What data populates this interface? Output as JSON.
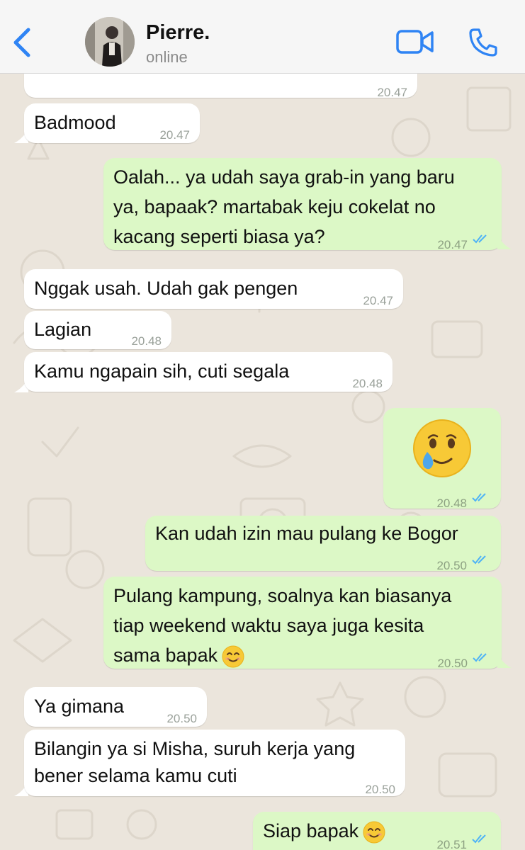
{
  "header": {
    "contact_name": "Pierre.",
    "status": "online"
  },
  "colors": {
    "accent": "#2f84f4",
    "outgoing_bubble": "#dcf8c6",
    "incoming_bubble": "#ffffff",
    "read_ticks": "#4fb3f6",
    "wallpaper": "#ebe5dc"
  },
  "messages": [
    {
      "dir": "in",
      "lines": [
        ""
      ],
      "time": "20.47"
    },
    {
      "dir": "in",
      "lines": [
        "Badmood"
      ],
      "time": "20.47"
    },
    {
      "dir": "out",
      "lines": [
        "Oalah... ya udah saya grab-in yang baru",
        "ya, bapaak? martabak keju cokelat no",
        "kacang seperti biasa ya?"
      ],
      "time": "20.47",
      "read": true
    },
    {
      "dir": "in",
      "lines": [
        "Nggak usah. Udah gak pengen"
      ],
      "time": "20.47"
    },
    {
      "dir": "in",
      "lines": [
        "Lagian"
      ],
      "time": "20.48"
    },
    {
      "dir": "in",
      "lines": [
        "Kamu ngapain sih, cuti segala"
      ],
      "time": "20.48"
    },
    {
      "dir": "out",
      "emoji": "face-holding-back-tears",
      "time": "20.48",
      "read": true
    },
    {
      "dir": "out",
      "lines": [
        "Kan udah izin mau pulang ke Bogor"
      ],
      "time": "20.50",
      "read": true
    },
    {
      "dir": "out",
      "lines": [
        "Pulang kampung, soalnya kan biasanya",
        "tiap weekend waktu saya juga kesita",
        "sama bapak"
      ],
      "time": "20.50",
      "read": true,
      "trailing_emoji": "smiling-face"
    },
    {
      "dir": "in",
      "lines": [
        "Ya gimana"
      ],
      "time": "20.50"
    },
    {
      "dir": "in",
      "lines": [
        "Bilangin ya si Misha, suruh kerja yang",
        "bener selama kamu cuti"
      ],
      "time": "20.50"
    },
    {
      "dir": "out",
      "lines": [
        "Siap bapak"
      ],
      "time": "20.51",
      "read": true,
      "trailing_emoji": "smiling-face"
    }
  ]
}
